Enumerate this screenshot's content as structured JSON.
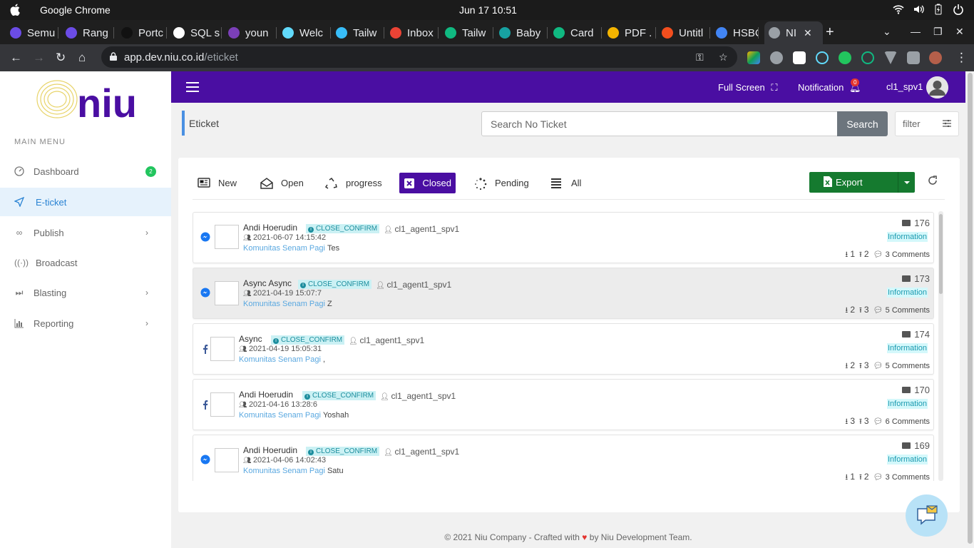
{
  "os": {
    "app_name": "Google Chrome",
    "clock": "Jun 17  10:51"
  },
  "browser": {
    "tabs": [
      {
        "label": "Semu",
        "color": "#6b4ce6"
      },
      {
        "label": "Rang",
        "color": "#6b4ce6"
      },
      {
        "label": "Portc",
        "color": "#111111"
      },
      {
        "label": "SQL s",
        "color": "#ffffff"
      },
      {
        "label": "youn",
        "color": "#7b3fb8"
      },
      {
        "label": "Welc",
        "color": "#61dafb"
      },
      {
        "label": "Tailw",
        "color": "#38bdf8"
      },
      {
        "label": "Inbox",
        "color": "#ea4335"
      },
      {
        "label": "Tailw",
        "color": "#10b981"
      },
      {
        "label": "Baby",
        "color": "#17a2a2"
      },
      {
        "label": "Card",
        "color": "#10b981"
      },
      {
        "label": "PDF .",
        "color": "#f4b400"
      },
      {
        "label": "Untitl",
        "color": "#f24e1e"
      },
      {
        "label": "HSBC",
        "color": "#4285f4"
      },
      {
        "label": "NI",
        "color": "#9aa0a6"
      }
    ],
    "url_host": "app.dev.niu.co.id",
    "url_path": "/eticket"
  },
  "sidebar": {
    "logo_text": "niu",
    "menu_title": "MAIN MENU",
    "items": [
      {
        "label": "Dashboard",
        "icon": "gauge-icon",
        "badge": "2"
      },
      {
        "label": "E-ticket",
        "icon": "send-icon"
      },
      {
        "label": "Publish",
        "icon": "link-icon"
      },
      {
        "label": "Broadcast",
        "icon": "broadcast-icon"
      },
      {
        "label": "Blasting",
        "icon": "fast-forward-icon"
      },
      {
        "label": "Reporting",
        "icon": "chart-icon"
      }
    ]
  },
  "header": {
    "fullscreen_label": "Full Screen",
    "notification_label": "Notification",
    "notification_count": "0",
    "username": "cl1_spv1"
  },
  "page": {
    "title": "Eticket",
    "search_placeholder": "Search No Ticket",
    "search_button": "Search",
    "filter_label": "filter"
  },
  "status_tabs": [
    {
      "label": "New",
      "icon": "newspaper-icon"
    },
    {
      "label": "Open",
      "icon": "envelope-open-icon"
    },
    {
      "label": "progress",
      "icon": "recycle-icon"
    },
    {
      "label": "Closed",
      "icon": "close-box-icon"
    },
    {
      "label": "Pending",
      "icon": "spinner-icon"
    },
    {
      "label": "All",
      "icon": "list-icon"
    }
  ],
  "export_label": "Export",
  "tickets": [
    {
      "name": "Andi Hoerudin",
      "status": "CLOSE_CONFIRM",
      "agent": "cl1_agent1_spv1",
      "date": "2021-06-07 14:15:42",
      "community": "Komunitas Senam Pagi",
      "message": "Tes",
      "id": "176",
      "category": "Information",
      "down": "1",
      "up": "2",
      "comments": "3 Comments",
      "channel": "messenger"
    },
    {
      "name": "Async Async",
      "status": "CLOSE_CONFIRM",
      "agent": "cl1_agent1_spv1",
      "date": "2021-04-19 15:07:7",
      "community": "Komunitas Senam Pagi",
      "message": "Z",
      "id": "173",
      "category": "Information",
      "down": "2",
      "up": "3",
      "comments": "5 Comments",
      "channel": "messenger"
    },
    {
      "name": "Async",
      "status": "CLOSE_CONFIRM",
      "agent": "cl1_agent1_spv1",
      "date": "2021-04-19 15:05:31",
      "community": "Komunitas Senam Pagi",
      "message": ",",
      "id": "174",
      "category": "Information",
      "down": "2",
      "up": "3",
      "comments": "5 Comments",
      "channel": "facebook"
    },
    {
      "name": "Andi Hoerudin",
      "status": "CLOSE_CONFIRM",
      "agent": "cl1_agent1_spv1",
      "date": "2021-04-16 13:28:6",
      "community": "Komunitas Senam Pagi",
      "message": "Yoshah",
      "id": "170",
      "category": "Information",
      "down": "3",
      "up": "3",
      "comments": "6 Comments",
      "channel": "facebook"
    },
    {
      "name": "Andi Hoerudin",
      "status": "CLOSE_CONFIRM",
      "agent": "cl1_agent1_spv1",
      "date": "2021-04-06 14:02:43",
      "community": "Komunitas Senam Pagi",
      "message": "Satu",
      "id": "169",
      "category": "Information",
      "down": "1",
      "up": "2",
      "comments": "3 Comments",
      "channel": "messenger"
    }
  ],
  "footer": {
    "left": "© 2021 Niu Company - Crafted with",
    "heart": "♥",
    "right": "by Niu Development Team."
  },
  "colors": {
    "brand_purple": "#4a0ea2",
    "export_green": "#157a2f",
    "active_blue": "#2a83d3"
  }
}
